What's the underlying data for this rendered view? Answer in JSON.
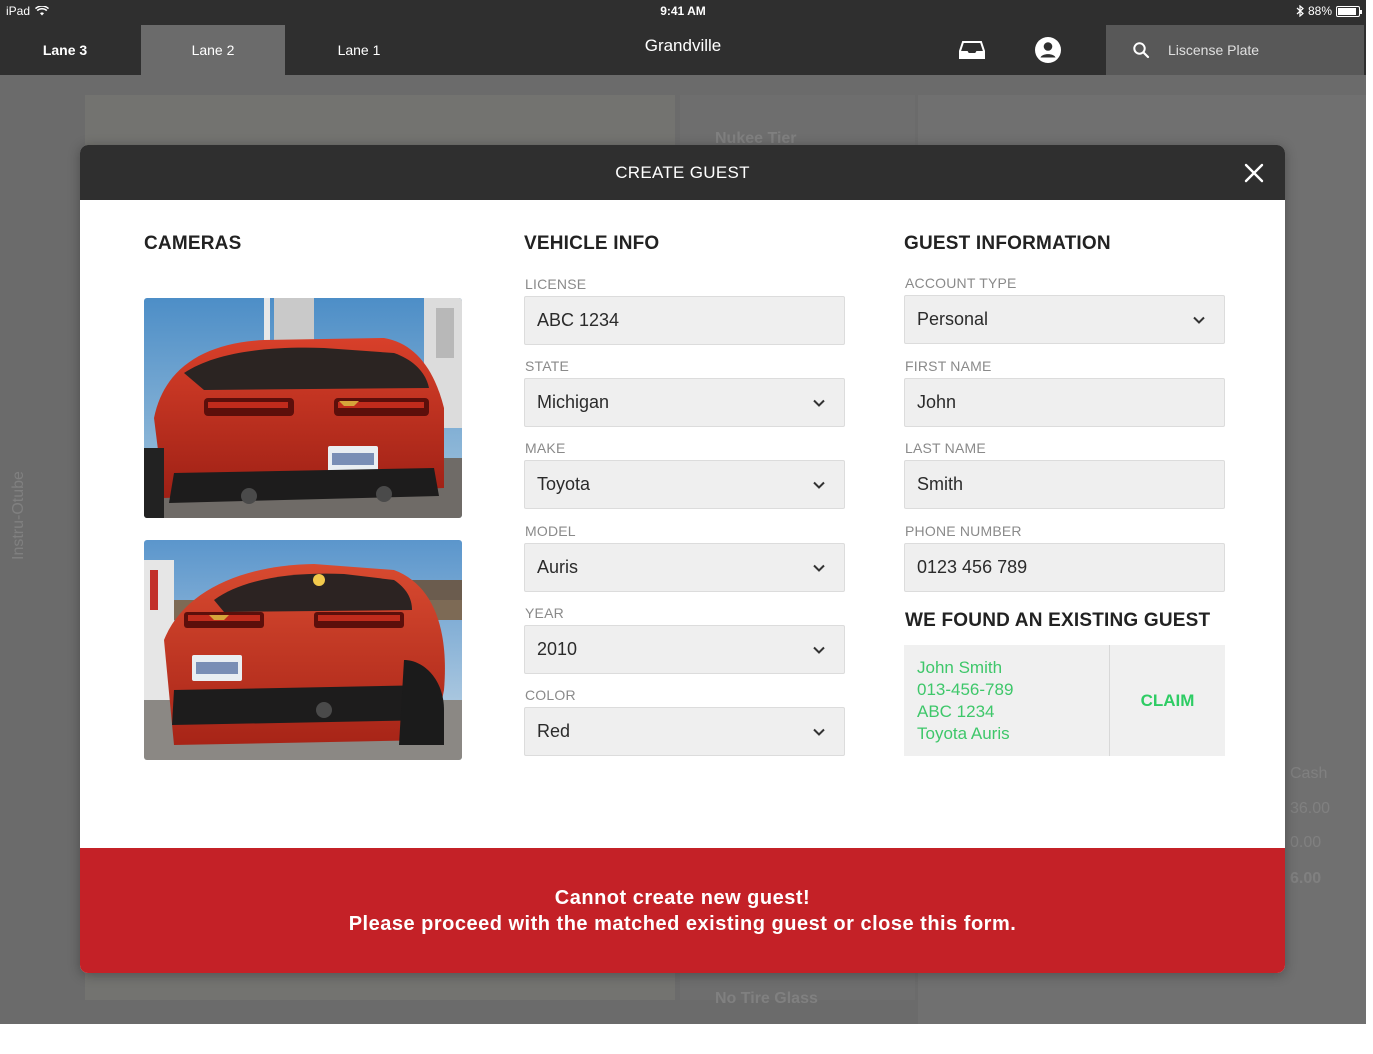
{
  "status": {
    "device": "iPad",
    "time": "9:41 AM",
    "battery": "88%",
    "battery_level": 0.88
  },
  "nav": {
    "tabs": [
      "Lane 3",
      "Lane 2",
      "Lane 1"
    ],
    "title": "Grandville",
    "search_placeholder": "Liscense Plate"
  },
  "background": {
    "top_label": "Nukee Tier",
    "side_label": "Instru-Otube",
    "amounts": [
      "Cash",
      "36.00",
      "0.00",
      "6.00"
    ],
    "bottom_label": "No Tire Glass"
  },
  "modal": {
    "title": "CREATE GUEST",
    "cameras": {
      "title": "CAMERAS"
    },
    "vehicle": {
      "title": "VEHICLE INFO",
      "license_label": "LICENSE",
      "license_value": "ABC 1234",
      "state_label": "STATE",
      "state_value": "Michigan",
      "make_label": "MAKE",
      "make_value": "Toyota",
      "model_label": "MODEL",
      "model_value": "Auris",
      "year_label": "YEAR",
      "year_value": "2010",
      "color_label": "COLOR",
      "color_value": "Red"
    },
    "guest": {
      "title": "GUEST INFORMATION",
      "account_type_label": "ACCOUNT TYPE",
      "account_type_value": "Personal",
      "first_name_label": "FIRST NAME",
      "first_name_value": "John",
      "last_name_label": "LAST NAME",
      "last_name_value": "Smith",
      "phone_label": "PHONE NUMBER",
      "phone_value": "0123 456 789"
    },
    "match": {
      "title": "WE FOUND AN EXISTING GUEST",
      "name": "John Smith",
      "phone": "013-456-789",
      "plate": "ABC 1234",
      "vehicle": "Toyota Auris",
      "claim_label": "CLAIM"
    },
    "error": {
      "line1": "Cannot create new guest!",
      "line2": "Please proceed with the matched existing guest or close this form."
    }
  },
  "colors": {
    "bar": "#2f2f2f",
    "overlay": "#6b6b6b",
    "error": "#c42127",
    "match_green": "#3ec76a",
    "claim_green": "#2ecc64"
  }
}
